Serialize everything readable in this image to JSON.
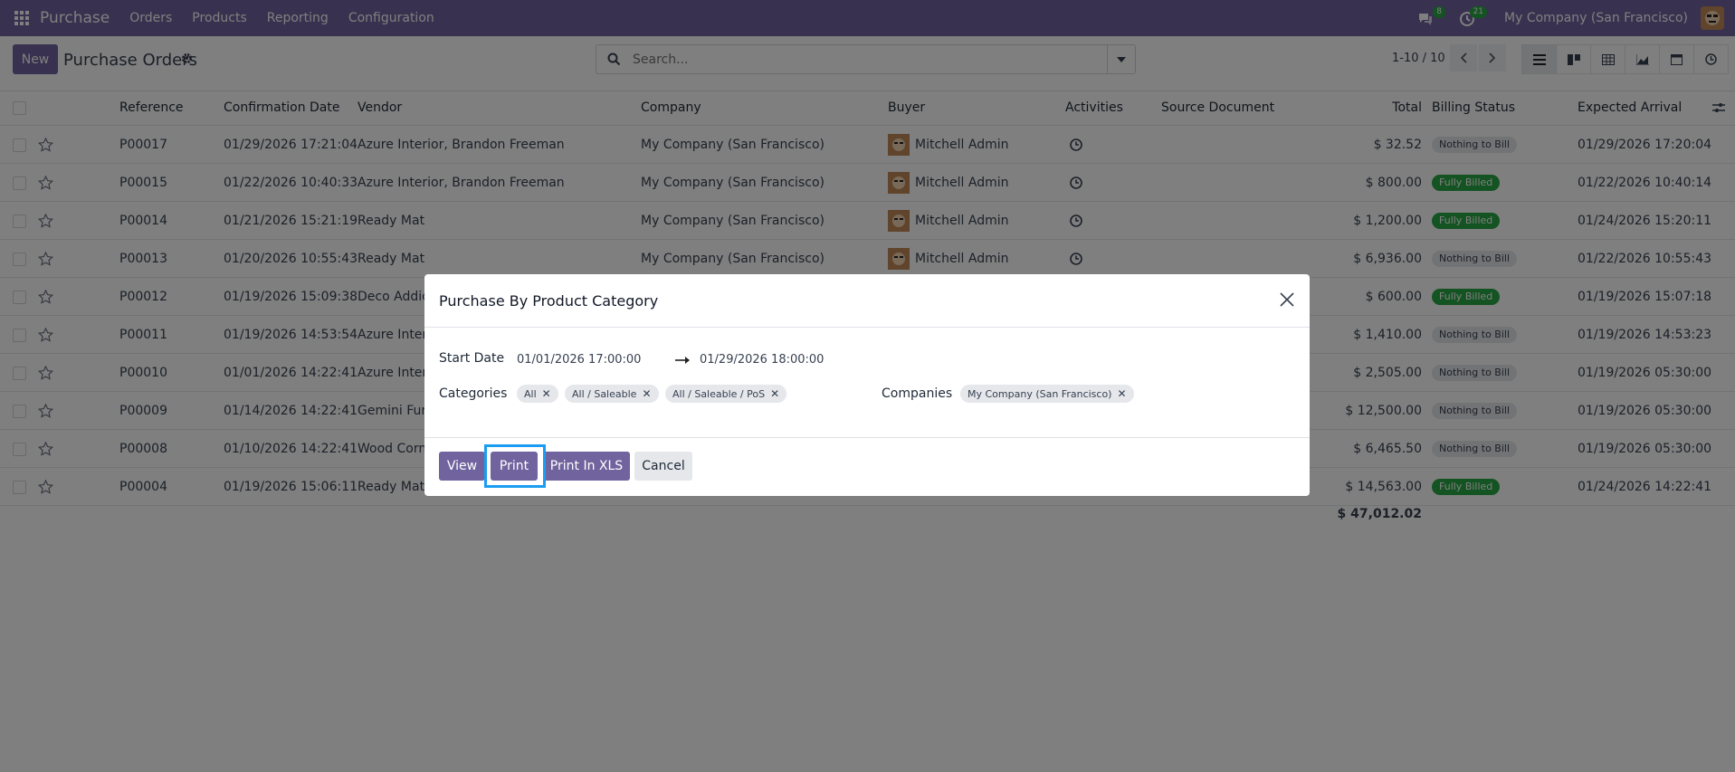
{
  "navbar": {
    "app_name": "Purchase",
    "menu": [
      "Orders",
      "Products",
      "Reporting",
      "Configuration"
    ],
    "messages_badge": "8",
    "activities_badge": "21",
    "company": "My Company (San Francisco)"
  },
  "control": {
    "new_label": "New",
    "title": "Purchase Orders",
    "search_placeholder": "Search...",
    "pager": "1-10 / 10"
  },
  "table": {
    "headers": {
      "reference": "Reference",
      "confirmation_date": "Confirmation Date",
      "vendor": "Vendor",
      "company": "Company",
      "buyer": "Buyer",
      "activities": "Activities",
      "source_document": "Source Document",
      "total": "Total",
      "billing_status": "Billing Status",
      "expected_arrival": "Expected Arrival"
    },
    "rows": [
      {
        "ref": "P00017",
        "date": "01/29/2026 17:21:04",
        "vendor": "Azure Interior, Brandon Freeman",
        "company": "My Company (San Francisco)",
        "buyer": "Mitchell Admin",
        "total": "$ 32.52",
        "status": "Nothing to Bill",
        "arrival": "01/29/2026 17:20:04"
      },
      {
        "ref": "P00015",
        "date": "01/22/2026 10:40:33",
        "vendor": "Azure Interior, Brandon Freeman",
        "company": "My Company (San Francisco)",
        "buyer": "Mitchell Admin",
        "total": "$ 800.00",
        "status": "Fully Billed",
        "arrival": "01/22/2026 10:40:14"
      },
      {
        "ref": "P00014",
        "date": "01/21/2026 15:21:19",
        "vendor": "Ready Mat",
        "company": "My Company (San Francisco)",
        "buyer": "Mitchell Admin",
        "total": "$ 1,200.00",
        "status": "Fully Billed",
        "arrival": "01/24/2026 15:20:11"
      },
      {
        "ref": "P00013",
        "date": "01/20/2026 10:55:43",
        "vendor": "Ready Mat",
        "company": "My Company (San Francisco)",
        "buyer": "Mitchell Admin",
        "total": "$ 6,936.00",
        "status": "Nothing to Bill",
        "arrival": "01/22/2026 10:55:43"
      },
      {
        "ref": "P00012",
        "date": "01/19/2026 15:09:38",
        "vendor": "Deco Addict",
        "company": "",
        "buyer": "",
        "total": "$ 600.00",
        "status": "Fully Billed",
        "arrival": "01/19/2026 15:07:18"
      },
      {
        "ref": "P00011",
        "date": "01/19/2026 14:53:54",
        "vendor": "Azure Interi",
        "company": "",
        "buyer": "",
        "total": "$ 1,410.00",
        "status": "Nothing to Bill",
        "arrival": "01/19/2026 14:53:23"
      },
      {
        "ref": "P00010",
        "date": "01/01/2026 14:22:41",
        "vendor": "Azure Interi",
        "company": "",
        "buyer": "",
        "total": "$ 2,505.00",
        "status": "Nothing to Bill",
        "arrival": "01/19/2026 05:30:00"
      },
      {
        "ref": "P00009",
        "date": "01/14/2026 14:22:41",
        "vendor": "Gemini Furn",
        "company": "",
        "buyer": "",
        "total": "$ 12,500.00",
        "status": "Nothing to Bill",
        "arrival": "01/19/2026 05:30:00"
      },
      {
        "ref": "P00008",
        "date": "01/10/2026 14:22:41",
        "vendor": "Wood Corne",
        "company": "",
        "buyer": "",
        "total": "$ 6,465.50",
        "status": "Nothing to Bill",
        "arrival": "01/19/2026 05:30:00"
      },
      {
        "ref": "P00004",
        "date": "01/19/2026 15:06:11",
        "vendor": "Ready Mat",
        "company": "",
        "buyer": "",
        "total": "$ 14,563.00",
        "status": "Fully Billed",
        "arrival": "01/24/2026 14:22:41"
      }
    ],
    "grand_total": "$ 47,012.02"
  },
  "dialog": {
    "title": "Purchase By Product Category",
    "start_date_label": "Start Date",
    "start_date": "01/01/2026 17:00:00",
    "end_date": "01/29/2026 18:00:00",
    "categories_label": "Categories",
    "categories": [
      "All",
      "All / Saleable",
      "All / Saleable / PoS"
    ],
    "companies_label": "Companies",
    "companies": [
      "My Company (San Francisco)"
    ],
    "buttons": {
      "view": "View",
      "print": "Print",
      "print_xls": "Print In XLS",
      "cancel": "Cancel"
    }
  }
}
